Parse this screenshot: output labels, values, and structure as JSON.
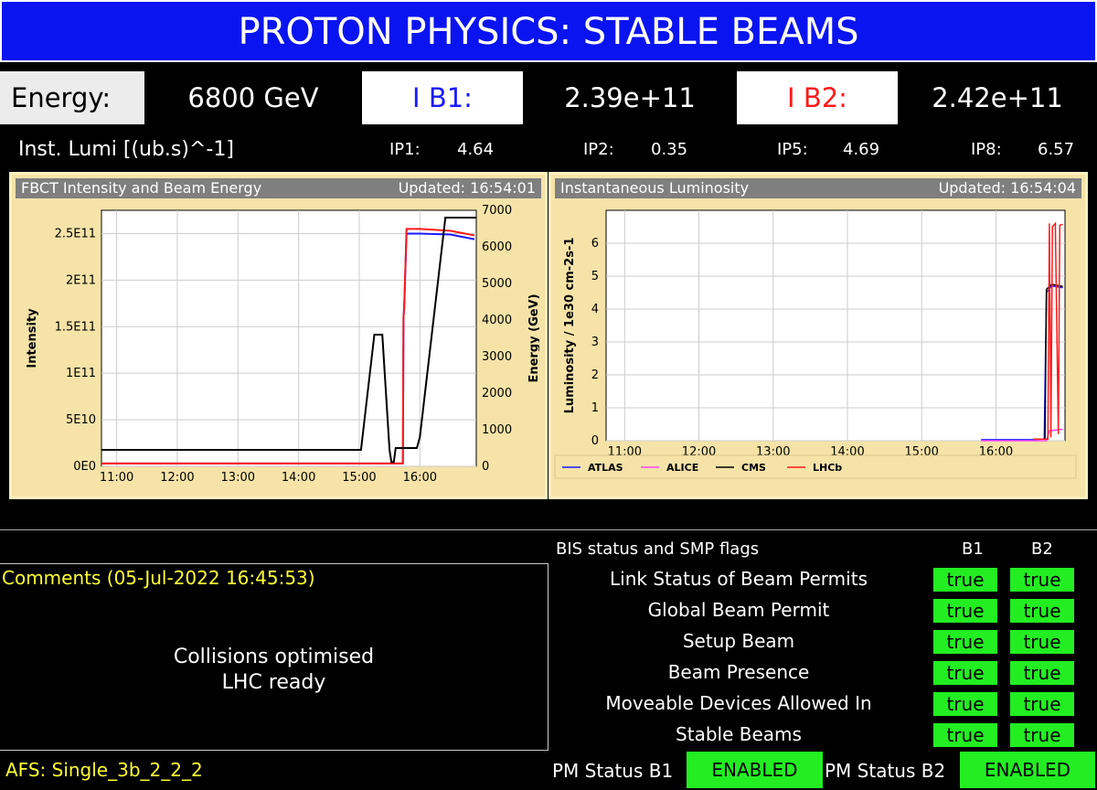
{
  "title": "PROTON PHYSICS: STABLE BEAMS",
  "energy": {
    "label": "Energy:",
    "value": "6800 GeV"
  },
  "ib1": {
    "label": "I B1:",
    "value": "2.39e+11",
    "color": "#1a1aff"
  },
  "ib2": {
    "label": "I B2:",
    "value": "2.42e+11",
    "color": "#ff1a1a"
  },
  "lumi": {
    "label": "Inst. Lumi [(ub.s)^-1]",
    "ips": [
      {
        "name": "IP1:",
        "value": "4.64"
      },
      {
        "name": "IP2:",
        "value": "0.35"
      },
      {
        "name": "IP5:",
        "value": "4.69"
      },
      {
        "name": "IP8:",
        "value": "6.57"
      }
    ]
  },
  "fbct_panel": {
    "title": "FBCT Intensity and Beam Energy",
    "updated": "Updated: 16:54:01"
  },
  "lumi_panel": {
    "title": "Instantaneous Luminosity",
    "updated": "Updated: 16:54:04"
  },
  "chart_data": [
    {
      "type": "line",
      "ylabel": "Intensity",
      "y2label": "Energy (GeV)",
      "x_ticks": [
        "11:00",
        "12:00",
        "13:00",
        "14:00",
        "15:00",
        "16:00"
      ],
      "y_ticks": [
        "0E0",
        "5E10",
        "1E11",
        "1.5E11",
        "2E11",
        "2.5E11"
      ],
      "y2_ticks": [
        "0",
        "1000",
        "2000",
        "3000",
        "4000",
        "5000",
        "6000",
        "7000"
      ],
      "xlim": [
        10.75,
        16.93
      ],
      "ylim": [
        0,
        275000000000.0
      ],
      "y2lim": [
        0,
        7000
      ],
      "series": [
        {
          "color": "#1a1aff",
          "axis": "y",
          "points": [
            [
              10.75,
              3000000000.0
            ],
            [
              15.65,
              3000000000.0
            ],
            [
              15.72,
              3000000000.0
            ],
            [
              15.73,
              160000000000.0
            ],
            [
              15.74,
              170000000000.0
            ],
            [
              15.78,
              250000000000.0
            ],
            [
              16.0,
              250000000000.0
            ],
            [
              16.5,
              249000000000.0
            ],
            [
              16.9,
              244000000000.0
            ]
          ]
        },
        {
          "color": "#ff1a1a",
          "axis": "y",
          "points": [
            [
              10.75,
              3000000000.0
            ],
            [
              15.65,
              3000000000.0
            ],
            [
              15.72,
              3000000000.0
            ],
            [
              15.73,
              160000000000.0
            ],
            [
              15.74,
              170000000000.0
            ],
            [
              15.78,
              255000000000.0
            ],
            [
              16.0,
              255000000000.0
            ],
            [
              16.5,
              253000000000.0
            ],
            [
              16.9,
              248000000000.0
            ]
          ]
        },
        {
          "color": "#000000",
          "axis": "y2",
          "points": [
            [
              10.75,
              450
            ],
            [
              15.03,
              450
            ],
            [
              15.25,
              3600
            ],
            [
              15.38,
              3600
            ],
            [
              15.5,
              450
            ],
            [
              15.53,
              120
            ],
            [
              15.57,
              120
            ],
            [
              15.6,
              500
            ],
            [
              15.95,
              500
            ],
            [
              16.0,
              800
            ],
            [
              16.42,
              6800
            ],
            [
              16.93,
              6800
            ]
          ]
        }
      ]
    },
    {
      "type": "line",
      "ylabel": "Luminosity / 1e30 cm-2s-1",
      "x_ticks": [
        "11:00",
        "12:00",
        "13:00",
        "14:00",
        "15:00",
        "16:00"
      ],
      "y_ticks": [
        "0",
        "1",
        "2",
        "3",
        "4",
        "5",
        "6"
      ],
      "xlim": [
        10.75,
        16.93
      ],
      "ylim": [
        0,
        7
      ],
      "legend_position": "bottom",
      "series": [
        {
          "name": "ATLAS",
          "color": "#1a1aff",
          "points": [
            [
              15.8,
              0.03
            ],
            [
              16.5,
              0.03
            ],
            [
              16.65,
              0.05
            ],
            [
              16.68,
              4.5
            ],
            [
              16.75,
              4.7
            ],
            [
              16.9,
              4.65
            ]
          ]
        },
        {
          "name": "ALICE",
          "color": "#ff44ff",
          "points": [
            [
              15.8,
              0.0
            ],
            [
              16.68,
              0.0
            ],
            [
              16.72,
              0.3
            ],
            [
              16.9,
              0.35
            ]
          ]
        },
        {
          "name": "CMS",
          "color": "#000000",
          "points": [
            [
              16.66,
              0.05
            ],
            [
              16.68,
              4.6
            ],
            [
              16.75,
              4.75
            ],
            [
              16.9,
              4.69
            ]
          ]
        },
        {
          "name": "LHCb",
          "color": "#ff1a1a",
          "points": [
            [
              16.5,
              0.05
            ],
            [
              16.7,
              0.05
            ],
            [
              16.72,
              6.6
            ],
            [
              16.74,
              0.1
            ],
            [
              16.76,
              6.5
            ],
            [
              16.8,
              6.6
            ],
            [
              16.84,
              0.2
            ],
            [
              16.86,
              6.55
            ],
            [
              16.9,
              6.57
            ]
          ]
        }
      ]
    }
  ],
  "comments": {
    "header": "Comments (05-Jul-2022 16:45:53)",
    "line1": "Collisions optimised",
    "line2": "LHC ready"
  },
  "afs": "AFS: Single_3b_2_2_2",
  "bis": {
    "title": "BIS status and SMP flags",
    "col_b1": "B1",
    "col_b2": "B2",
    "rows": [
      {
        "label": "Link Status of Beam Permits",
        "b1": "true",
        "b2": "true"
      },
      {
        "label": "Global Beam Permit",
        "b1": "true",
        "b2": "true"
      },
      {
        "label": "Setup Beam",
        "b1": "true",
        "b2": "true"
      },
      {
        "label": "Beam Presence",
        "b1": "true",
        "b2": "true"
      },
      {
        "label": "Moveable Devices Allowed In",
        "b1": "true",
        "b2": "true"
      },
      {
        "label": "Stable Beams",
        "b1": "true",
        "b2": "true"
      }
    ]
  },
  "pm": {
    "b1_label": "PM Status B1",
    "b1_value": "ENABLED",
    "b2_label": "PM Status B2",
    "b2_value": "ENABLED"
  }
}
